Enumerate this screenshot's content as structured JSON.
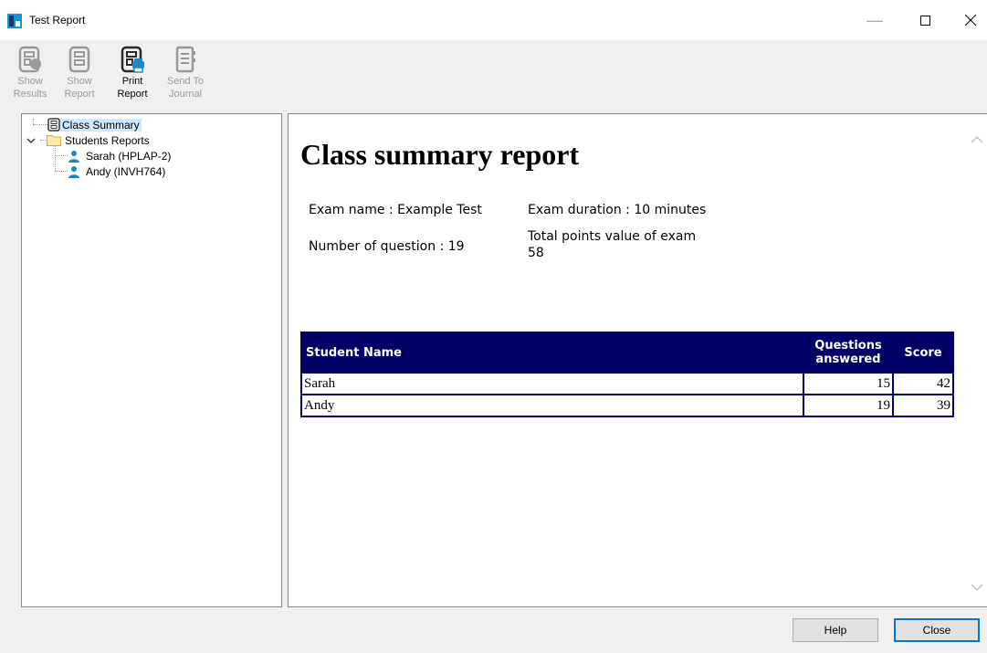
{
  "window": {
    "title": "Test Report",
    "icon": "app-icon"
  },
  "toolbar": {
    "items": [
      {
        "label": "Show\nResults",
        "icon": "show-results-icon",
        "enabled": false
      },
      {
        "label": "Show\nReport",
        "icon": "show-report-icon",
        "enabled": false
      },
      {
        "label": "Print\nReport",
        "icon": "print-report-icon",
        "enabled": true
      },
      {
        "label": "Send To\nJournal",
        "icon": "send-to-journal-icon",
        "enabled": false
      }
    ]
  },
  "tree": {
    "class_summary": "Class Summary",
    "students_reports": "Students Reports",
    "students": [
      "Sarah (HPLAP-2)",
      "Andy (INVH764)"
    ]
  },
  "report": {
    "title": "Class summary report",
    "exam_name": "Exam name : Example Test",
    "exam_duration": "Exam duration : 10 minutes",
    "num_questions": "Number of question : 19",
    "total_points_label": "Total points value of exam",
    "total_points_value": "58",
    "table": {
      "headers": [
        "Student Name",
        "Questions answered",
        "Score"
      ],
      "rows": [
        [
          "Sarah",
          "15",
          "42"
        ],
        [
          "Andy",
          "19",
          "39"
        ]
      ]
    }
  },
  "buttons": {
    "help": "Help",
    "close": "Close"
  },
  "colors": {
    "header_bg": "#000066",
    "selection": "#cce8ff",
    "accent": "#0078d7"
  }
}
